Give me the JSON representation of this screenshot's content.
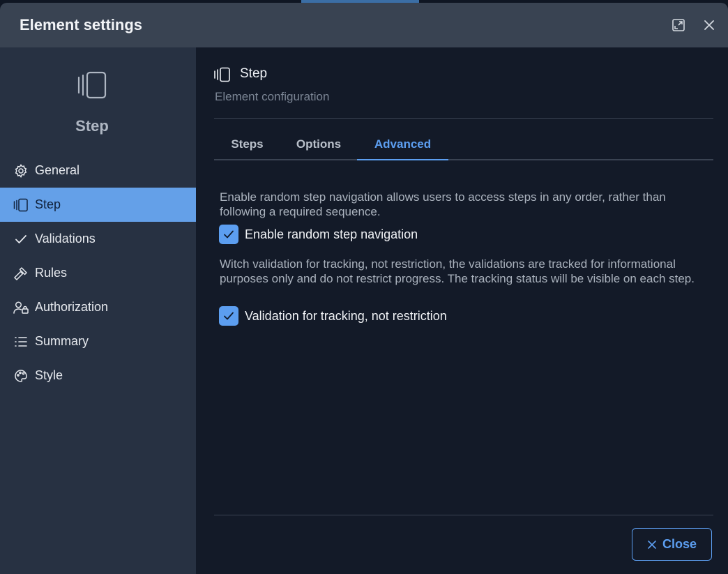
{
  "dialog": {
    "title": "Element settings",
    "icons": {
      "expand": "expand-icon",
      "close": "close-icon"
    }
  },
  "sidebar": {
    "hero_title": "Step",
    "hero_icon": "step-icon",
    "items": [
      {
        "label": "General",
        "icon": "gear-icon",
        "active": false
      },
      {
        "label": "Step",
        "icon": "step-icon",
        "active": true
      },
      {
        "label": "Validations",
        "icon": "check-icon",
        "active": false
      },
      {
        "label": "Rules",
        "icon": "gavel-icon",
        "active": false
      },
      {
        "label": "Authorization",
        "icon": "user-lock-icon",
        "active": false
      },
      {
        "label": "Summary",
        "icon": "list-icon",
        "active": false
      },
      {
        "label": "Style",
        "icon": "palette-icon",
        "active": false
      }
    ]
  },
  "main": {
    "title": "Step",
    "subtitle": "Element configuration",
    "tabs": [
      {
        "label": "Steps",
        "active": false
      },
      {
        "label": "Options",
        "active": false
      },
      {
        "label": "Advanced",
        "active": true
      }
    ],
    "advanced": {
      "random_nav_description": "Enable random step navigation allows users to access steps in any order, rather than following a required sequence.",
      "random_nav_label": "Enable random step navigation",
      "random_nav_checked": true,
      "tracking_description": "Witch validation for tracking, not restriction, the validations are tracked for informational purposes only and do not restrict progress. The tracking status will be visible on each step.",
      "tracking_label": "Validation for tracking, not restriction",
      "tracking_checked": true
    }
  },
  "footer": {
    "close_label": "Close"
  },
  "colors": {
    "accent": "#5c9ef0",
    "active_nav": "#64a0e8",
    "header": "#394352",
    "sidebar": "#273142",
    "main": "#131a28"
  }
}
